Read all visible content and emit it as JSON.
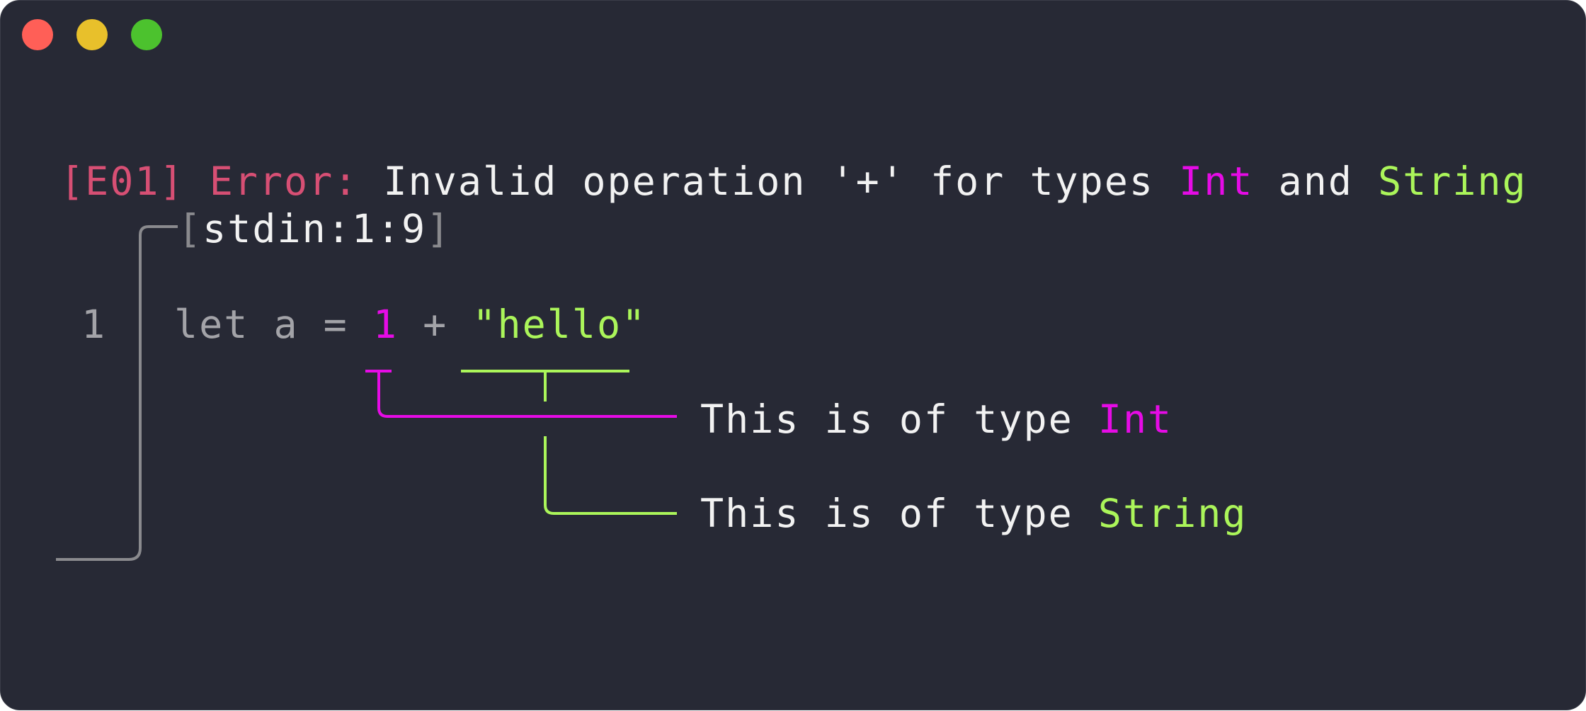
{
  "window": {
    "buttons": [
      {
        "name": "close",
        "color": "#ff5f57"
      },
      {
        "name": "minimize",
        "color": "#e8c02b"
      },
      {
        "name": "maximize",
        "color": "#4cc22e"
      }
    ]
  },
  "error": {
    "code": "[E01]",
    "label": "Error:",
    "message": "Invalid operation '+' for types",
    "type_int": "Int",
    "conjunction": "and",
    "type_string": "String"
  },
  "location": {
    "open_bracket": "[",
    "text": "stdin:1:9",
    "close_bracket": "]"
  },
  "source": {
    "line_number": "1",
    "code_prefix": "let a =",
    "int_literal": "1",
    "operator": "+",
    "string_literal": "\"hello\""
  },
  "annotations": {
    "int": {
      "text": "This is of type",
      "type": "Int"
    },
    "string": {
      "text": "This is of type",
      "type": "String"
    }
  },
  "colors": {
    "background": "#272935",
    "error": "#d74f74",
    "magenta": "#e60be6",
    "green": "#abf55a",
    "text": "#f2f2f2",
    "dim": "#a3a3a8",
    "frame": "#8a8a8e"
  }
}
